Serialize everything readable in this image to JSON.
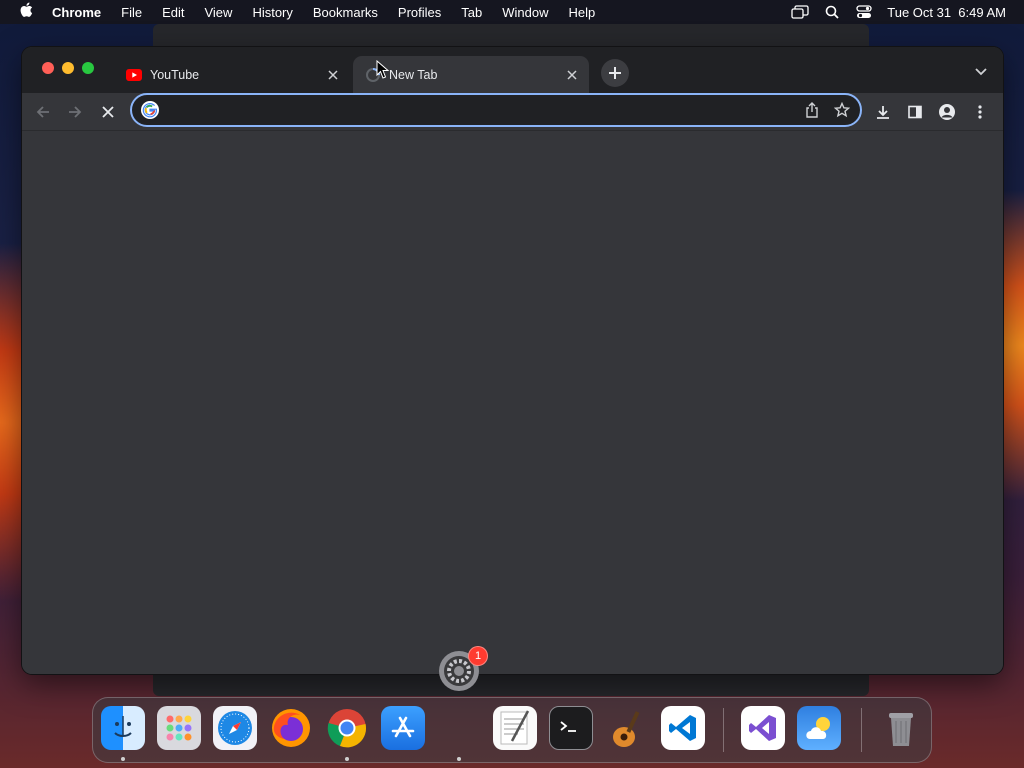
{
  "menubar": {
    "app_name": "Chrome",
    "items": [
      "File",
      "Edit",
      "View",
      "History",
      "Bookmarks",
      "Profiles",
      "Tab",
      "Window",
      "Help"
    ],
    "datetime": "Tue Oct 31  6:49 AM"
  },
  "browser": {
    "tabs": [
      {
        "title": "YouTube",
        "favicon": "youtube-icon",
        "active": false
      },
      {
        "title": "New Tab",
        "favicon": "loading-icon",
        "active": true
      }
    ],
    "omnibox": {
      "value": "",
      "placeholder": ""
    },
    "colors": {
      "focus_ring": "#8ab4f8",
      "frame": "#202124",
      "toolbar": "#35363a"
    }
  },
  "notification_badge": "1",
  "dock": {
    "apps": [
      "Finder",
      "Launchpad",
      "Safari",
      "Firefox",
      "Google Chrome",
      "App Store",
      "TextEdit",
      "Terminal",
      "GarageBand",
      "Visual Studio Code",
      "Visual Studio",
      "Weather",
      "Trash"
    ]
  }
}
